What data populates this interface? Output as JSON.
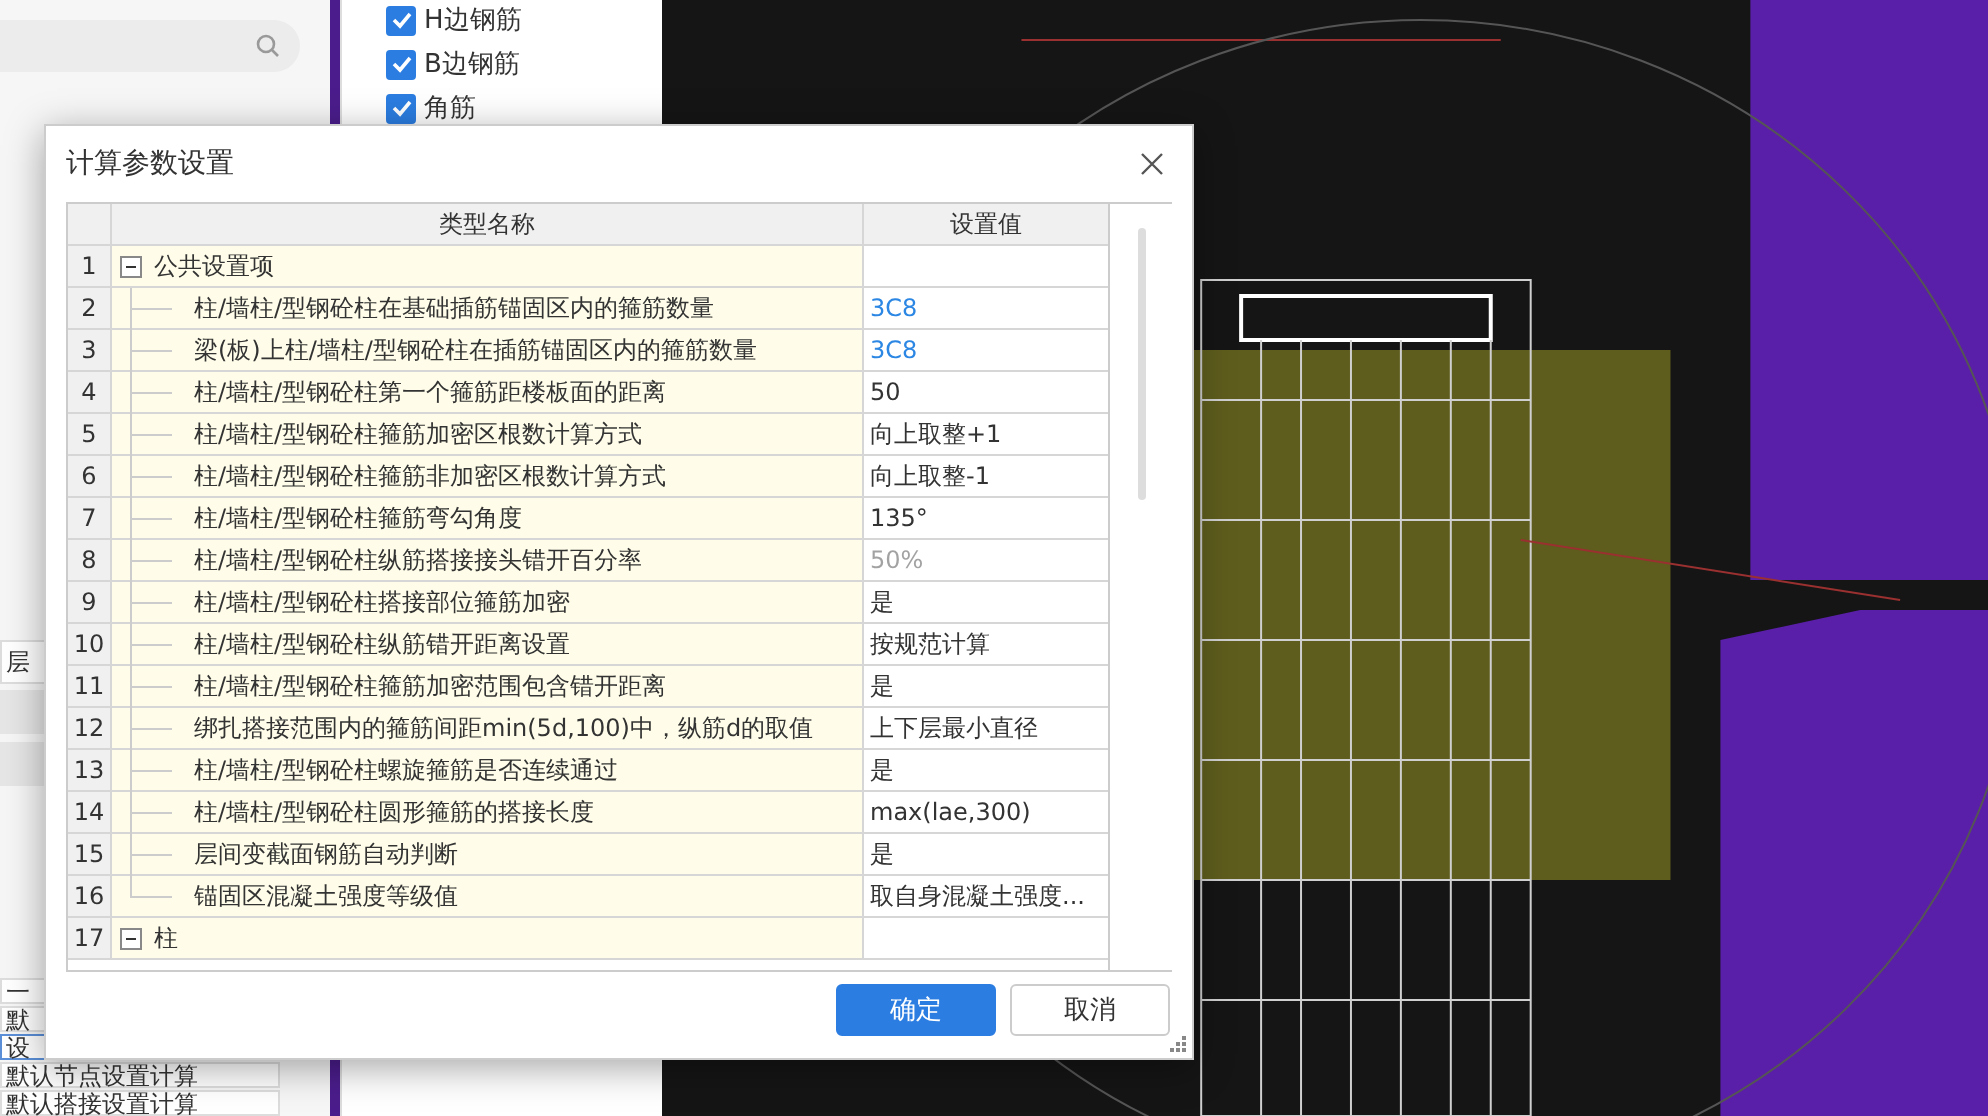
{
  "layer_options": [
    {
      "label": "H边钢筋",
      "checked": true
    },
    {
      "label": "B边钢筋",
      "checked": true
    },
    {
      "label": "角筋",
      "checked": true
    }
  ],
  "side_list": [
    {
      "label": "层",
      "selected": false
    },
    {
      "label": "一",
      "selected": false
    },
    {
      "label": "默",
      "selected": false
    },
    {
      "label": "设",
      "selected": true
    },
    {
      "label": "默认节点设置计算",
      "selected": false
    },
    {
      "label": "默认搭接设置计算",
      "selected": false
    }
  ],
  "dialog": {
    "title": "计算参数设置",
    "columns": [
      "类型名称",
      "设置值"
    ],
    "rows": [
      {
        "number": "1",
        "kind": "group",
        "expanded": true,
        "name": "公共设置项"
      },
      {
        "number": "2",
        "kind": "item",
        "name": "柱/墙柱/型钢砼柱在基础插筋锚固区内的箍筋数量",
        "value": "3C8",
        "linked": true,
        "disabled": false
      },
      {
        "number": "3",
        "kind": "item",
        "name": "梁(板)上柱/墙柱/型钢砼柱在插筋锚固区内的箍筋数量",
        "value": "3C8",
        "linked": true,
        "disabled": false
      },
      {
        "number": "4",
        "kind": "item",
        "name": "柱/墙柱/型钢砼柱第一个箍筋距楼板面的距离",
        "value": "50",
        "linked": false,
        "disabled": false
      },
      {
        "number": "5",
        "kind": "item",
        "name": "柱/墙柱/型钢砼柱箍筋加密区根数计算方式",
        "value": "向上取整+1",
        "linked": false,
        "disabled": false
      },
      {
        "number": "6",
        "kind": "item",
        "name": "柱/墙柱/型钢砼柱箍筋非加密区根数计算方式",
        "value": "向上取整-1",
        "linked": false,
        "disabled": false
      },
      {
        "number": "7",
        "kind": "item",
        "name": "柱/墙柱/型钢砼柱箍筋弯勾角度",
        "value": "135°",
        "linked": false,
        "disabled": false
      },
      {
        "number": "8",
        "kind": "item",
        "name": "柱/墙柱/型钢砼柱纵筋搭接接头错开百分率",
        "value": "50%",
        "linked": false,
        "disabled": true
      },
      {
        "number": "9",
        "kind": "item",
        "name": "柱/墙柱/型钢砼柱搭接部位箍筋加密",
        "value": "是",
        "linked": false,
        "disabled": false
      },
      {
        "number": "10",
        "kind": "item",
        "name": "柱/墙柱/型钢砼柱纵筋错开距离设置",
        "value": "按规范计算",
        "linked": false,
        "disabled": false
      },
      {
        "number": "11",
        "kind": "item",
        "name": "柱/墙柱/型钢砼柱箍筋加密范围包含错开距离",
        "value": "是",
        "linked": false,
        "disabled": false
      },
      {
        "number": "12",
        "kind": "item",
        "name": "绑扎搭接范围内的箍筋间距min(5d,100)中，纵筋d的取值",
        "value": "上下层最小直径",
        "linked": false,
        "disabled": false
      },
      {
        "number": "13",
        "kind": "item",
        "name": "柱/墙柱/型钢砼柱螺旋箍筋是否连续通过",
        "value": "是",
        "linked": false,
        "disabled": false
      },
      {
        "number": "14",
        "kind": "item",
        "name": "柱/墙柱/型钢砼柱圆形箍筋的搭接长度",
        "value": "max(lae,300)",
        "linked": false,
        "disabled": false
      },
      {
        "number": "15",
        "kind": "item",
        "name": "层间变截面钢筋自动判断",
        "value": "是",
        "linked": false,
        "disabled": false
      },
      {
        "number": "16",
        "kind": "last_item",
        "name": "锚固区混凝土强度等级值",
        "value": "取自身混凝土强度...",
        "linked": false,
        "disabled": false
      },
      {
        "number": "17",
        "kind": "group",
        "expanded": true,
        "name": "柱"
      }
    ],
    "buttons": [
      {
        "label": "确定",
        "kind": "primary"
      },
      {
        "label": "取消",
        "kind": "secondary"
      }
    ]
  }
}
